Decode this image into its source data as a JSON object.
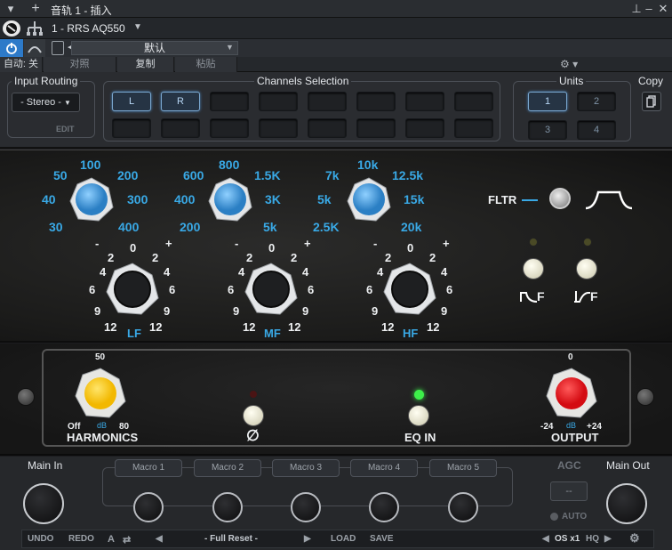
{
  "window": {
    "title": "音轨 1 - 插入"
  },
  "host": {
    "track_name": "1 - RRS AQ550",
    "preset": "默认",
    "auto_label": "自动: 关",
    "compare_label": "对照",
    "copy_label": "复制",
    "paste_label": "粘贴"
  },
  "top": {
    "input_routing": {
      "label": "Input Routing",
      "value": "- Stereo -",
      "edit": "EDIT"
    },
    "channels": {
      "label": "Channels Selection",
      "buttons": [
        "L",
        "R"
      ]
    },
    "units": {
      "label": "Units",
      "buttons": [
        "1",
        "2",
        "3",
        "4"
      ]
    },
    "copy": {
      "label": "Copy"
    }
  },
  "eq": {
    "lf": {
      "band": "LF",
      "freqs": [
        "50",
        "100",
        "200",
        "40",
        "300",
        "30",
        "400"
      ]
    },
    "mf": {
      "band": "MF",
      "freqs": [
        "600",
        "800",
        "1.5K",
        "400",
        "3K",
        "200",
        "5k"
      ]
    },
    "hf": {
      "band": "HF",
      "freqs": [
        "7k",
        "10k",
        "12.5k",
        "5k",
        "15k",
        "2.5K",
        "20k"
      ]
    },
    "gain_scale": [
      "0",
      "2",
      "2",
      "4",
      "4",
      "6",
      "6",
      "9",
      "9",
      "12",
      "12",
      "-",
      "+"
    ],
    "filter": {
      "label": "FLTR",
      "lf": "F",
      "hf": "F"
    }
  },
  "lower": {
    "harmonics": {
      "label": "HARMONICS",
      "top": "50",
      "off": "Off",
      "db": "dB",
      "max": "80"
    },
    "output": {
      "label": "OUTPUT",
      "top": "0",
      "min": "-24",
      "db": "dB",
      "max": "+24"
    },
    "eq_in": {
      "label": "EQ IN"
    },
    "phase": {
      "symbol": "∅"
    }
  },
  "bottom": {
    "main_in": "Main In",
    "main_out": "Main Out",
    "agc": "AGC",
    "agc_value": "--",
    "auto": "AUTO",
    "macros": [
      "Macro 1",
      "Macro 2",
      "Macro 3",
      "Macro 4",
      "Macro 5"
    ]
  },
  "footer": {
    "undo": "UNDO",
    "redo": "REDO",
    "a": "A",
    "preset": "- Full Reset -",
    "load": "LOAD",
    "save": "SAVE",
    "os": "OS x1",
    "hq": "HQ"
  },
  "colors": {
    "accent_blue": "#39a9e6",
    "harmonics_knob": "#ffcc11",
    "output_knob": "#e8141b",
    "eq_in_led": "#3df04a"
  }
}
